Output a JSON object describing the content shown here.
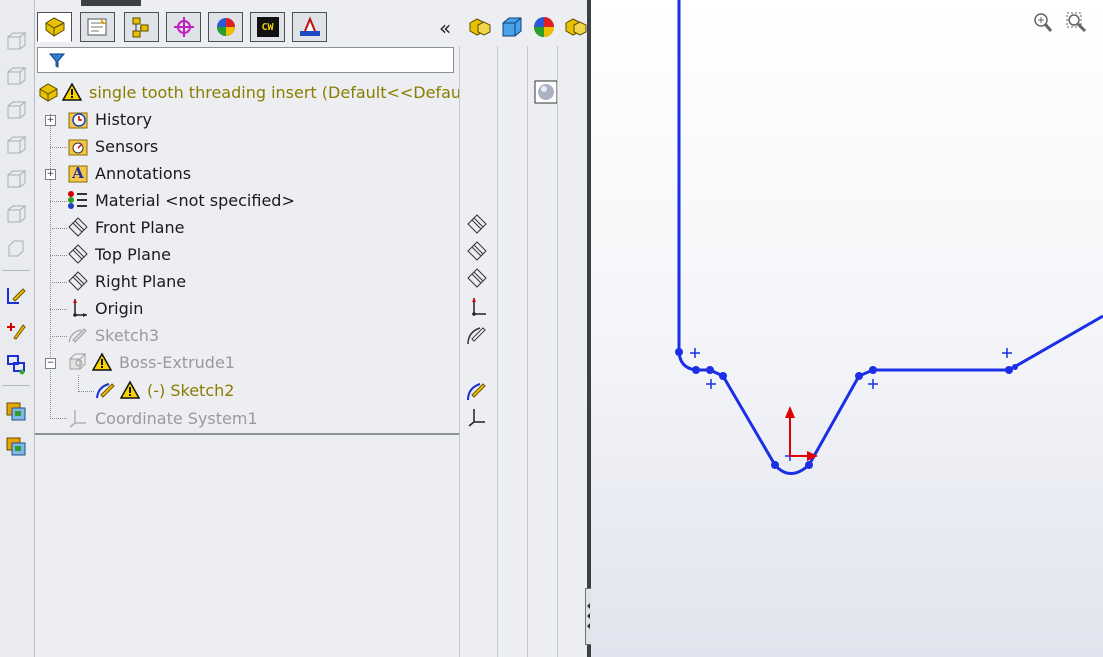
{
  "tabs": [
    {
      "name": "featuremanager-tab",
      "icon": "featuremanager-icon"
    },
    {
      "name": "propertymanager-tab",
      "icon": "propertymanager-icon"
    },
    {
      "name": "configurationmanager-tab",
      "icon": "configurationmanager-icon"
    },
    {
      "name": "dimxpert-tab",
      "icon": "dimxpert-icon"
    },
    {
      "name": "display-manager-tab",
      "icon": "display-manager-icon"
    },
    {
      "name": "cam-tab",
      "icon": "cam-icon",
      "text": "CW"
    },
    {
      "name": "simulation-tab",
      "icon": "simulation-icon"
    }
  ],
  "collapse_glyph": "«",
  "tree": {
    "root": {
      "label": "single tooth threading insert  (Default<<Defau",
      "icons": [
        "part-icon",
        "warning-icon"
      ]
    },
    "items": [
      {
        "label": "History",
        "icon": "history-icon",
        "expandable": true
      },
      {
        "label": "Sensors",
        "icon": "sensors-icon",
        "expandable": false
      },
      {
        "label": "Annotations",
        "icon": "annotations-icon",
        "expandable": true,
        "icon_text": "A"
      },
      {
        "label": "Material <not specified>",
        "icon": "material-icon",
        "expandable": false
      },
      {
        "label": "Front Plane",
        "icon": "plane-icon",
        "expandable": false
      },
      {
        "label": "Top Plane",
        "icon": "plane-icon",
        "expandable": false
      },
      {
        "label": "Right Plane",
        "icon": "plane-icon",
        "expandable": false
      },
      {
        "label": "Origin",
        "icon": "origin-icon",
        "expandable": false
      },
      {
        "label": "Sketch3",
        "icon": "sketch-icon",
        "expandable": false,
        "state": "suppressed"
      },
      {
        "label": "Boss-Extrude1",
        "icon": "extrude-icon",
        "expandable": true,
        "state": "suppressed-warning"
      },
      {
        "label": "(-) Sketch2",
        "icon": "sketch-icon",
        "expandable": false,
        "state": "warning"
      },
      {
        "label": "Coordinate System1",
        "icon": "coordinate-system-icon",
        "expandable": false,
        "state": "suppressed"
      }
    ]
  },
  "left_toolbar": [
    "view-cube-icon",
    "view-cube-icon",
    "view-cube-icon",
    "view-cube-icon",
    "view-cube-icon",
    "view-cube-icon",
    "view-cube-icon",
    "edit-sketch-icon",
    "add-relation-icon",
    "sketch-entities-icon",
    "layer-icon",
    "layer-icon"
  ],
  "viewport_icons": [
    "zoom-to-fit-icon",
    "zoom-to-area-icon"
  ],
  "colors": {
    "sketch": "#1a2fe6",
    "origin_arrow": "#e00000",
    "panel_bg": "#eceef1",
    "olive_text": "#8a7d00",
    "muted_text": "#9a9a9a"
  }
}
